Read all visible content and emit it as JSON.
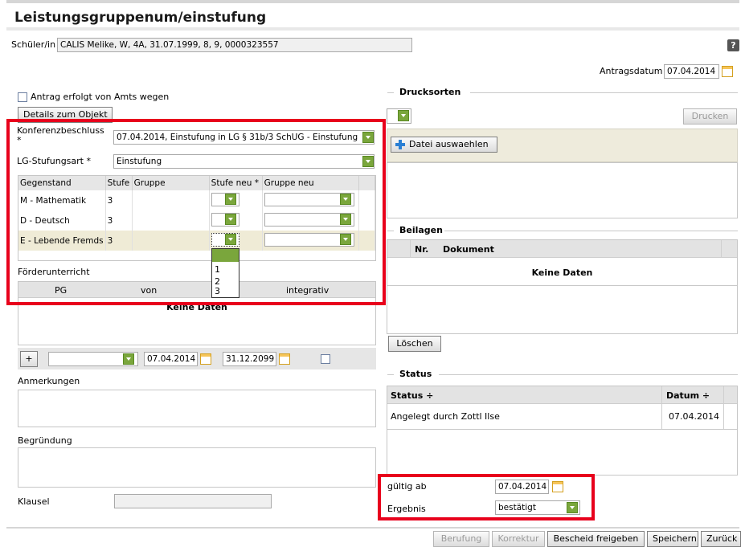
{
  "title": "Leistungsgruppenum/einstufung",
  "student": {
    "label": "Schüler/in",
    "value": "CALIS Melike, W, 4A, 31.07.1999, 8, 9, 0000323557"
  },
  "help": "?",
  "antragsdatum": {
    "label": "Antragsdatum *",
    "value": "07.04.2014"
  },
  "amts": {
    "label": "Antrag erfolgt von Amts wegen"
  },
  "details_button": "Details zum Objekt",
  "konferenz": {
    "label": "Konferenzbeschluss",
    "req": "*",
    "value": "07.04.2014, Einstufung in LG § 31b/3 SchUG - Einstufung"
  },
  "stufungsart": {
    "label": "LG-Stufungsart *",
    "value": "Einstufung"
  },
  "table": {
    "headers": [
      "Gegenstand",
      "Stufe",
      "Gruppe",
      "Stufe neu *",
      "Gruppe neu"
    ],
    "rows": [
      {
        "gegenstand": "M - Mathematik",
        "stufe": "3"
      },
      {
        "gegenstand": "D - Deutsch",
        "stufe": "3"
      },
      {
        "gegenstand": "E - Lebende Fremds",
        "stufe": "3"
      }
    ]
  },
  "dropdown_options": [
    "1",
    "2",
    "3"
  ],
  "foerder": {
    "label": "Förderunterricht",
    "headers": [
      "PG",
      "von",
      "integrativ"
    ],
    "empty": "Keine Daten",
    "add": "+",
    "von": "07.04.2014",
    "bis": "31.12.2099"
  },
  "anmerkungen": "Anmerkungen",
  "begruendung": "Begründung",
  "klausel": "Klausel",
  "drucksorten": {
    "title": "Drucksorten",
    "drucken": "Drucken",
    "datei": "Datei auswaehlen"
  },
  "beilagen": {
    "title": "Beilagen",
    "headers": [
      "Nr.",
      "Dokument"
    ],
    "empty": "Keine Daten",
    "loeschen": "Löschen"
  },
  "status": {
    "title": "Status",
    "headers": [
      "Status ÷",
      "Datum ÷"
    ],
    "row": {
      "status": "Angelegt durch Zottl Ilse",
      "datum": "07.04.2014"
    }
  },
  "gueltig": {
    "label": "gültig ab",
    "value": "07.04.2014"
  },
  "ergebnis": {
    "label": "Ergebnis",
    "value": "bestätigt"
  },
  "footer": {
    "berufung": "Berufung",
    "korrektur": "Korrektur",
    "freigeben": "Bescheid freigeben",
    "speichern": "Speichern",
    "zurueck": "Zurück"
  },
  "colors": {
    "accent_red": "#e8001c",
    "dropdown_green": "#7aa63c"
  }
}
